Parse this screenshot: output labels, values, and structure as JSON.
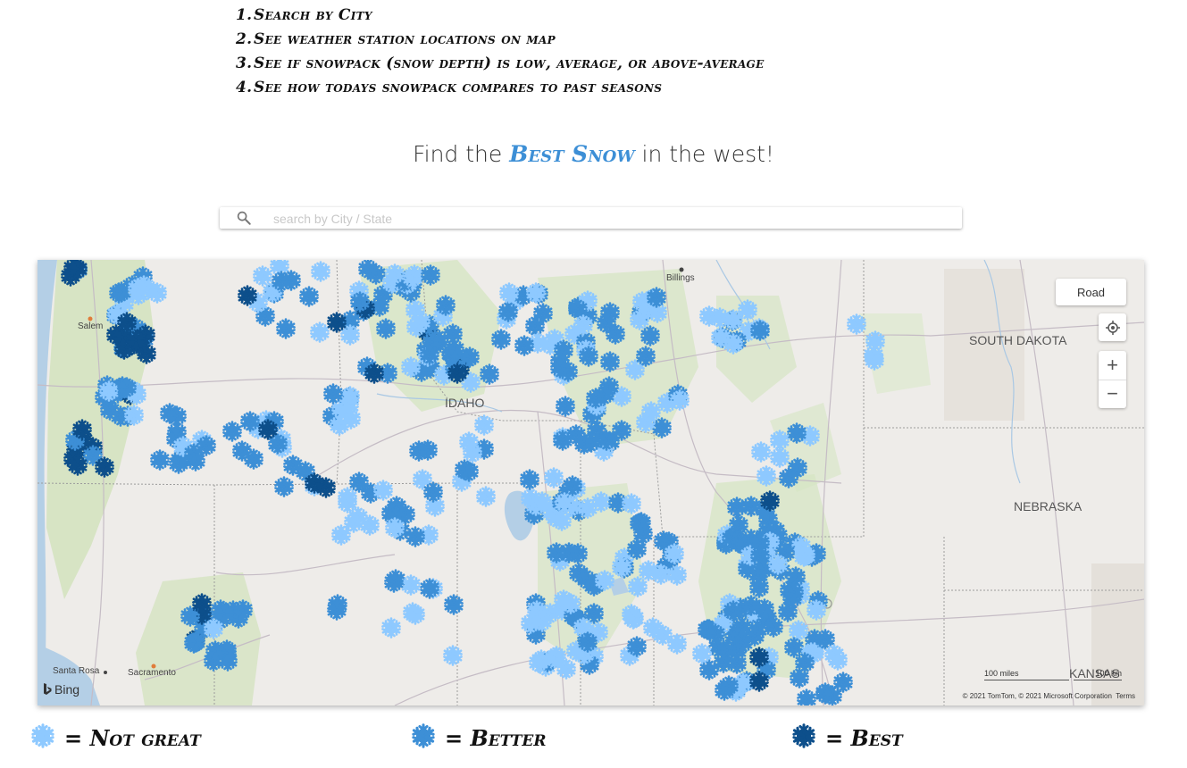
{
  "steps": [
    {
      "num": "1.",
      "text": "Search by City"
    },
    {
      "num": "2.",
      "text": "See weather station locations on map"
    },
    {
      "num": "3.",
      "text": "See if snowpack (snow depth) is low, average, or above-average"
    },
    {
      "num": "4.",
      "text": "See how todays snowpack compares to past seasons"
    }
  ],
  "tagline": {
    "before": "Find the",
    "accent": "Best Snow",
    "after": "in the west!"
  },
  "search": {
    "placeholder": "search by City / State",
    "value": ""
  },
  "map": {
    "style_button": "Road",
    "labels": {
      "idaho": "IDAHO",
      "south_dakota": "SOUTH DAKOTA",
      "nebraska": "NEBRASKA",
      "kansas": "KANSAS",
      "billings": "Billings",
      "salem": "Salem",
      "santa_rosa": "Santa Rosa",
      "sacramento": "Sacramento"
    },
    "bing": "Bing",
    "scale_miles": "100 miles",
    "scale_km": "100 km",
    "attribution": "© 2021 TomTom, © 2021 Microsoft Corporation",
    "terms": "Terms"
  },
  "colors": {
    "not_great": "#8ec9ff",
    "better": "#3d8fd6",
    "best": "#0d4f8b"
  },
  "legend": [
    {
      "key": "not_great",
      "label": "= Not great"
    },
    {
      "key": "better",
      "label": "= Better"
    },
    {
      "key": "best",
      "label": "= Best"
    }
  ]
}
